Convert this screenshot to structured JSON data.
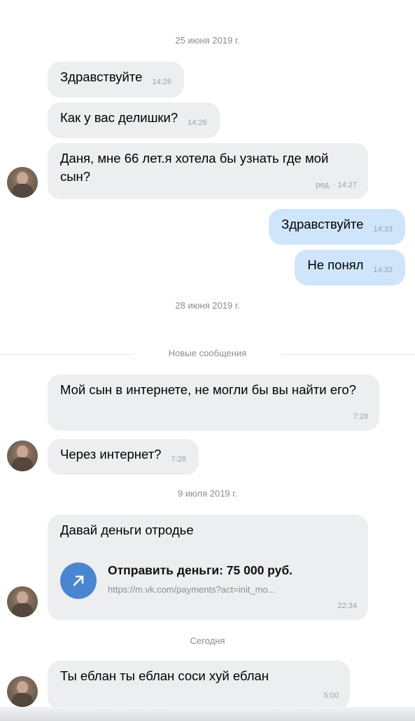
{
  "dates": {
    "d1": "25 июня 2019 г.",
    "d2": "28 июня 2019 г.",
    "d3": "9 июля 2019 г.",
    "d4": "Сегодня"
  },
  "new_messages_label": "Новые сообщения",
  "messages": [
    {
      "dir": "in",
      "text": "Здравствуйте",
      "time": "14:26"
    },
    {
      "dir": "in",
      "text": "Как у вас делишки?",
      "time": "14:26"
    },
    {
      "dir": "in",
      "text": "Даня, мне 66 лет.я хотела бы узнать где мой сын?",
      "time": "ред. · 14:27"
    },
    {
      "dir": "out",
      "text": "Здравствуйте",
      "time": "14:33"
    },
    {
      "dir": "out",
      "text": "Не понял",
      "time": "14:33"
    },
    {
      "dir": "in",
      "text": "Мой сын в интернете, не могли бы вы найти его?",
      "time": "7:28"
    },
    {
      "dir": "in",
      "text": "Через интернет?",
      "time": "7:28"
    },
    {
      "dir": "in",
      "text": "Давай деньги отродье",
      "time": "22:34",
      "attachment": {
        "title": "Отправить деньги: 75 000 руб.",
        "url": "https://m.vk.com/payments?act=init_mo...",
        "icon": "arrow-up-right-icon",
        "icon_color": "#4a86cf"
      }
    },
    {
      "dir": "in",
      "text": "Ты еблан ты еблан соси хуй еблан",
      "time": "5:00"
    }
  ],
  "colors": {
    "incoming_bubble": "#edeef0",
    "outgoing_bubble": "#cfe5fb",
    "meta_text": "#8a8d91"
  }
}
